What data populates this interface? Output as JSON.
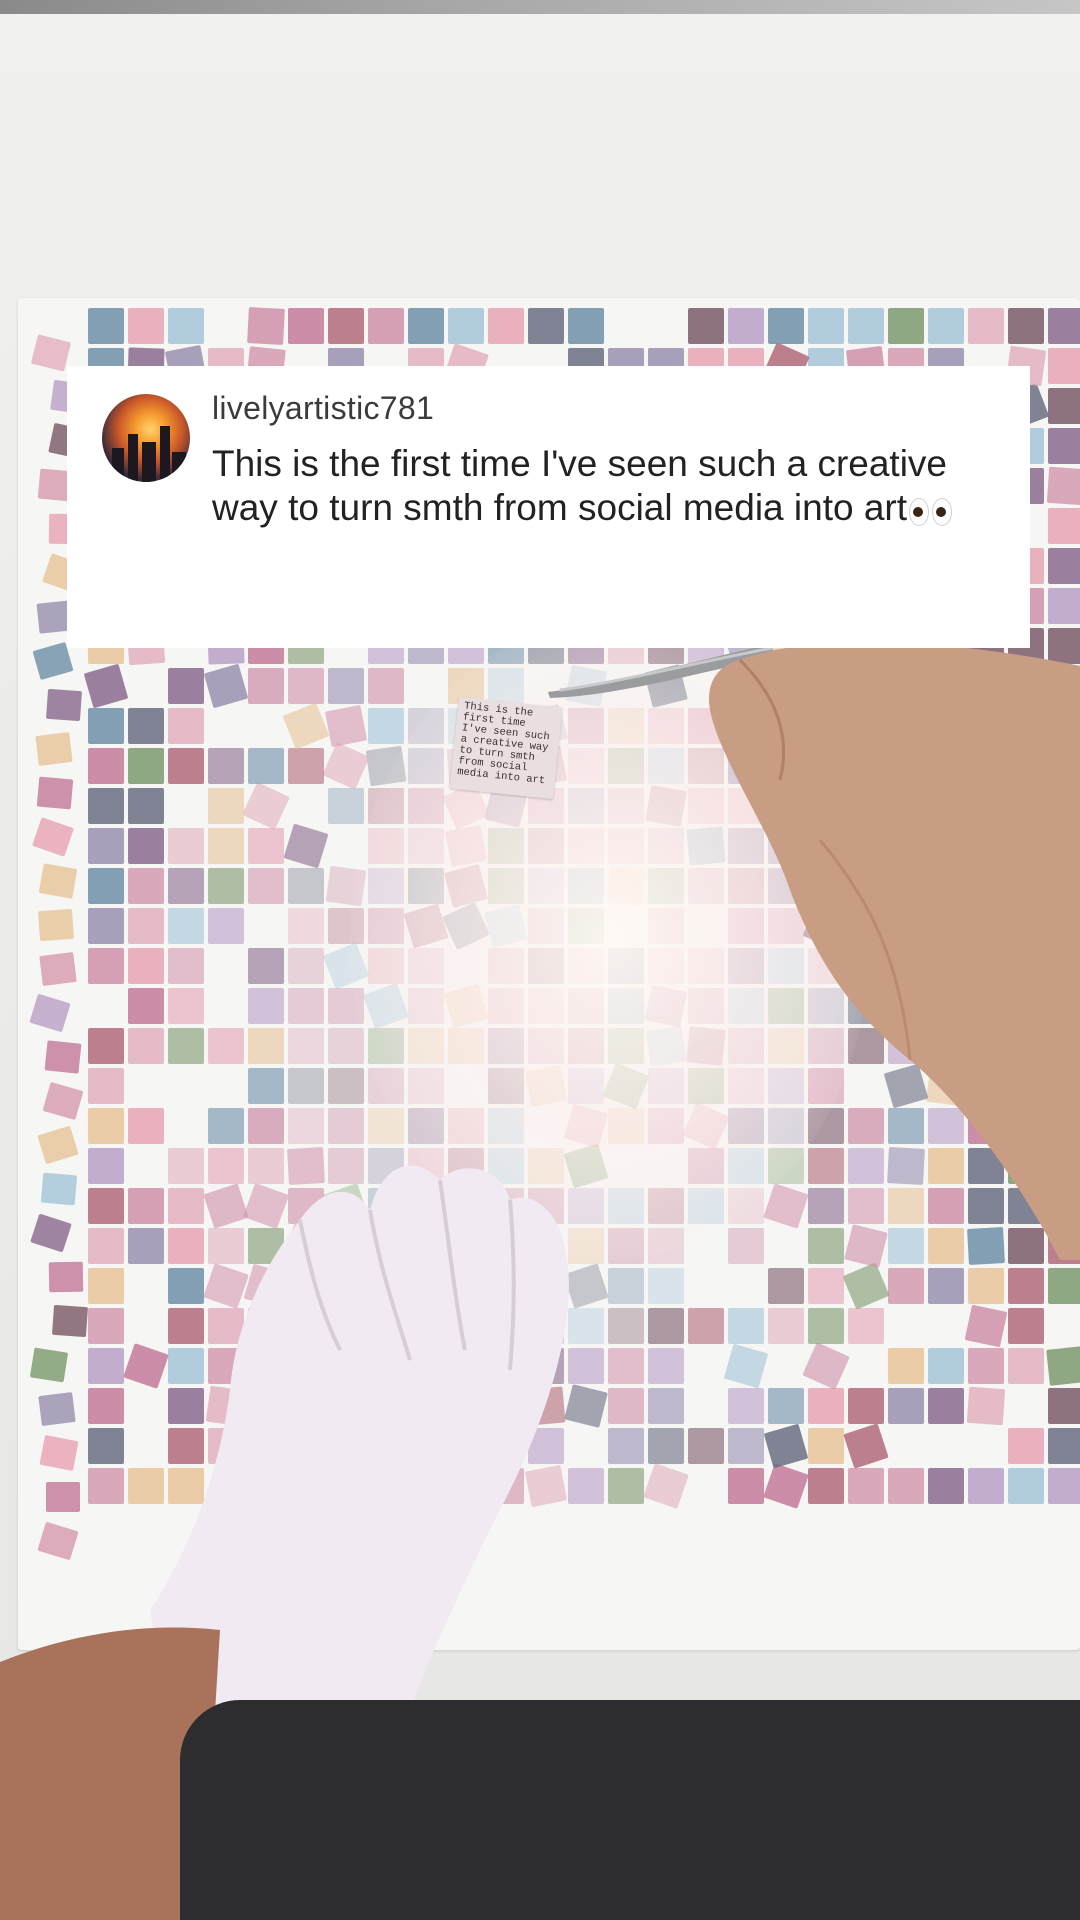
{
  "comment": {
    "username": "livelyartistic781",
    "text": "This is the first time I've seen such a creative way to turn smth from social media into art",
    "emoji": "eyes-emoji"
  },
  "paper_note": {
    "text": "This is the first time I've seen such a creative way to turn smth from social media into art"
  },
  "colors": {
    "card_background": "#ffffff",
    "username_color": "#3b3b3b",
    "text_color": "#222222"
  }
}
